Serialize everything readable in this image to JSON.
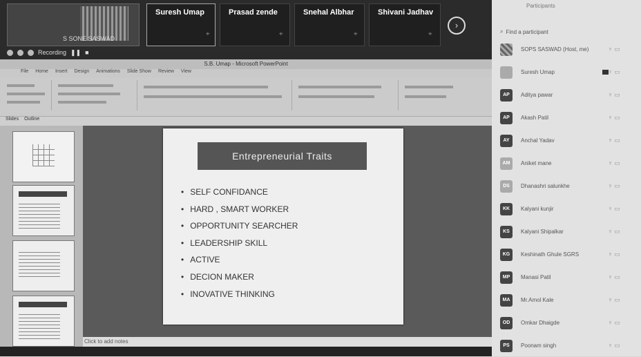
{
  "meeting": {
    "self_name": "S SONE SASWAD",
    "tiles": [
      {
        "name": "Suresh Umap"
      },
      {
        "name": "Prasad zende"
      },
      {
        "name": "Snehal Albhar"
      },
      {
        "name": "Shivani Jadhav"
      }
    ],
    "recording_label": "Recording",
    "next_icon": "chevron-right-icon"
  },
  "ppt": {
    "window_title": "S.B. Umap - Microsoft PowerPoint",
    "menu": [
      "File",
      "Home",
      "Insert",
      "Design",
      "Animations",
      "Slide Show",
      "Review",
      "View"
    ],
    "panel_tabs": [
      "Slides",
      "Outline"
    ],
    "slide": {
      "title": "Entrepreneurial  Traits",
      "bullets": [
        "SELF CONFIDANCE",
        "HARD , SMART WORKER",
        "OPPORTUNITY SEARCHER",
        "LEADERSHIP SKILL",
        "ACTIVE",
        "DECION MAKER",
        "INOVATIVE THINKING"
      ]
    },
    "notes_placeholder": "Click to add notes"
  },
  "participants": {
    "header": "Participants",
    "search_placeholder": "Find a participant",
    "list": [
      {
        "name": "SOPS SASWAD (Host, me)"
      },
      {
        "name": "Suresh Umap"
      },
      {
        "name": "Aditya pawar",
        "initials": "AP"
      },
      {
        "name": "Akash Patil",
        "initials": "AP"
      },
      {
        "name": "Anchal Yadav",
        "initials": "AY"
      },
      {
        "name": "Aniket mane",
        "initials": "AM"
      },
      {
        "name": "Dhanashri salunkhe",
        "initials": "DS"
      },
      {
        "name": "Kalyani kunjir",
        "initials": "KK"
      },
      {
        "name": "Kalyani Shipalkar",
        "initials": "KS"
      },
      {
        "name": "Keshinath Ghule SGRS",
        "initials": "KG"
      },
      {
        "name": "Manasi Patil",
        "initials": "MP"
      },
      {
        "name": "Mr.Amol Kale",
        "initials": "MA"
      },
      {
        "name": "Omkar Dhaigde",
        "initials": "OD"
      },
      {
        "name": "Poonam singh",
        "initials": "PS"
      }
    ]
  }
}
